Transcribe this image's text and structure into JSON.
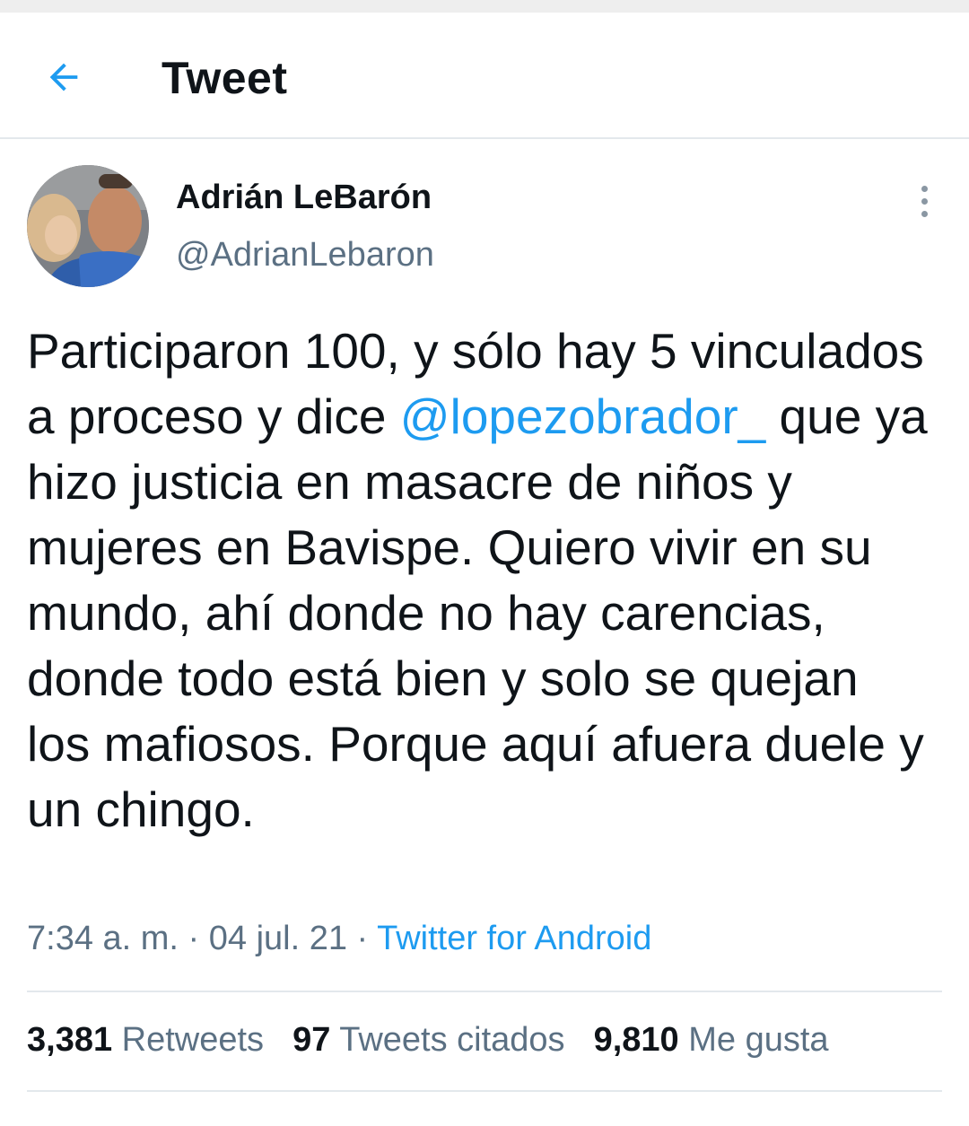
{
  "header": {
    "title": "Tweet",
    "back_icon": "back-arrow-icon",
    "accent_color": "#1d9bf0"
  },
  "tweet": {
    "author": {
      "display_name": "Adrián LeBarón",
      "handle": "@AdrianLebaron"
    },
    "text_parts": {
      "before_mention": "Participaron 100, y sólo hay 5 vinculados a proceso y dice ",
      "mention": "@lopezobrador_",
      "after_mention": " que ya hizo justicia en masacre de niños y mujeres en Bavispe. Quiero vivir en su mundo, ahí donde no hay carencias, donde todo está bien y solo se quejan los mafiosos. Porque aquí afuera duele y un chingo."
    },
    "time": "7:34 a. m.",
    "date": "04 jul. 21",
    "separator": " · ",
    "source": "Twitter for Android",
    "stats": {
      "retweets": {
        "count": "3,381",
        "label": "Retweets"
      },
      "quotes": {
        "count": "97",
        "label": "Tweets citados"
      },
      "likes": {
        "count": "9,810",
        "label": "Me gusta"
      }
    },
    "more_icon": "more-vertical-icon"
  }
}
